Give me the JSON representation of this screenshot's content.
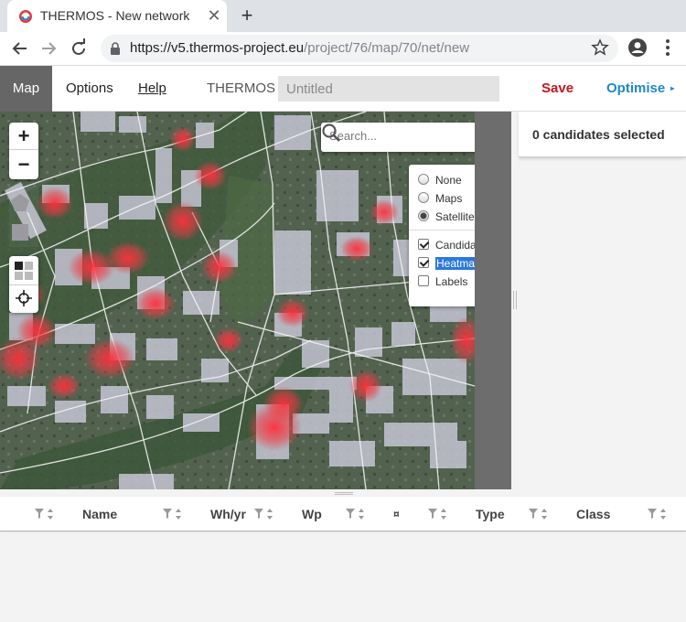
{
  "browser": {
    "tab_title": "THERMOS - New network",
    "url_host": "https://v5.thermos-project.eu",
    "url_path": "/project/76/map/70/net/new"
  },
  "nav": {
    "map": "Map",
    "options": "Options",
    "help": "Help",
    "brand": "THERMOS",
    "name_placeholder": "Untitled",
    "save": "Save",
    "optimise": "Optimise",
    "optimise_caret": "▸"
  },
  "map": {
    "zoom_in": "+",
    "zoom_out": "−",
    "search_placeholder": "Search...",
    "layers": {
      "base": [
        {
          "label": "None",
          "checked": false
        },
        {
          "label": "Maps",
          "checked": false
        },
        {
          "label": "Satellite",
          "checked": true
        }
      ],
      "overlays": [
        {
          "label": "Candidates",
          "checked": true
        },
        {
          "label": "Heatmap",
          "checked": true
        },
        {
          "label": "Labels",
          "checked": false
        }
      ]
    }
  },
  "side_panel": {
    "selected_text": "0 candidates selected"
  },
  "table": {
    "columns": [
      {
        "label": ""
      },
      {
        "label": "Name"
      },
      {
        "label": "Wh/yr"
      },
      {
        "label": "Wp"
      },
      {
        "label": "¤"
      },
      {
        "label": "Type"
      },
      {
        "label": "Class"
      }
    ]
  },
  "colors": {
    "save": "#c8141e",
    "optimise": "#1e88c8",
    "nav_active_bg": "#666666",
    "heat": "#e8323c"
  },
  "icons": [
    "favicon-icon",
    "close-icon",
    "plus-icon",
    "back-arrow-icon",
    "forward-arrow-icon",
    "reload-icon",
    "lock-icon",
    "star-icon",
    "account-icon",
    "kebab-menu-icon",
    "search-icon",
    "polygon-draw-icon",
    "rectangle-draw-icon",
    "layers-icon",
    "crosshair-icon",
    "filter-icon",
    "sort-icon"
  ]
}
